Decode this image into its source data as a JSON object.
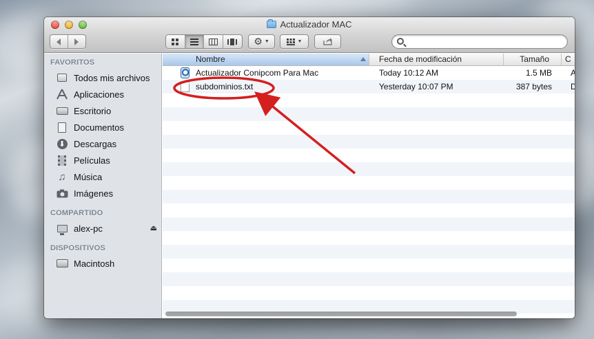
{
  "window": {
    "title": "Actualizador MAC",
    "traffic_lights": [
      "close",
      "minimize",
      "maximize"
    ]
  },
  "toolbar": {
    "back_icon": "chevron-left-icon",
    "forward_icon": "chevron-right-icon",
    "view_modes": [
      "icon-view",
      "list-view",
      "column-view",
      "coverflow-view"
    ],
    "active_view": "list-view",
    "action_menu_icon": "gear-icon",
    "arrange_menu_icon": "grid-icon",
    "share_icon": "share-icon",
    "search_placeholder": ""
  },
  "sidebar": {
    "sections": [
      {
        "title": "FAVORITOS",
        "items": [
          {
            "label": "Todos mis archivos",
            "icon": "all-files-icon"
          },
          {
            "label": "Aplicaciones",
            "icon": "applications-icon"
          },
          {
            "label": "Escritorio",
            "icon": "desktop-icon"
          },
          {
            "label": "Documentos",
            "icon": "documents-icon"
          },
          {
            "label": "Descargas",
            "icon": "downloads-icon"
          },
          {
            "label": "Películas",
            "icon": "movies-icon"
          },
          {
            "label": "Música",
            "icon": "music-icon"
          },
          {
            "label": "Imágenes",
            "icon": "pictures-icon"
          }
        ]
      },
      {
        "title": "COMPARTIDO",
        "items": [
          {
            "label": "alex-pc",
            "icon": "pc-icon",
            "eject": true
          }
        ]
      },
      {
        "title": "DISPOSITIVOS",
        "items": [
          {
            "label": "Macintosh",
            "icon": "hard-drive-icon"
          }
        ]
      }
    ]
  },
  "list": {
    "columns": [
      "Nombre",
      "Fecha de modificación",
      "Tamaño",
      "C"
    ],
    "sorted_column": "Nombre",
    "rows": [
      {
        "name": "Actualizador Conipcom  Para Mac",
        "date": "Today 10:12 AM",
        "size": "1.5 MB",
        "kind": "A",
        "icon": "app-icon"
      },
      {
        "name": "subdominios.txt",
        "date": "Yesterday 10:07 PM",
        "size": "387 bytes",
        "kind": "D",
        "icon": "text-file-icon"
      }
    ]
  },
  "annotation": {
    "color": "#d41f1f",
    "highlighted_item": "subdominios.txt"
  }
}
